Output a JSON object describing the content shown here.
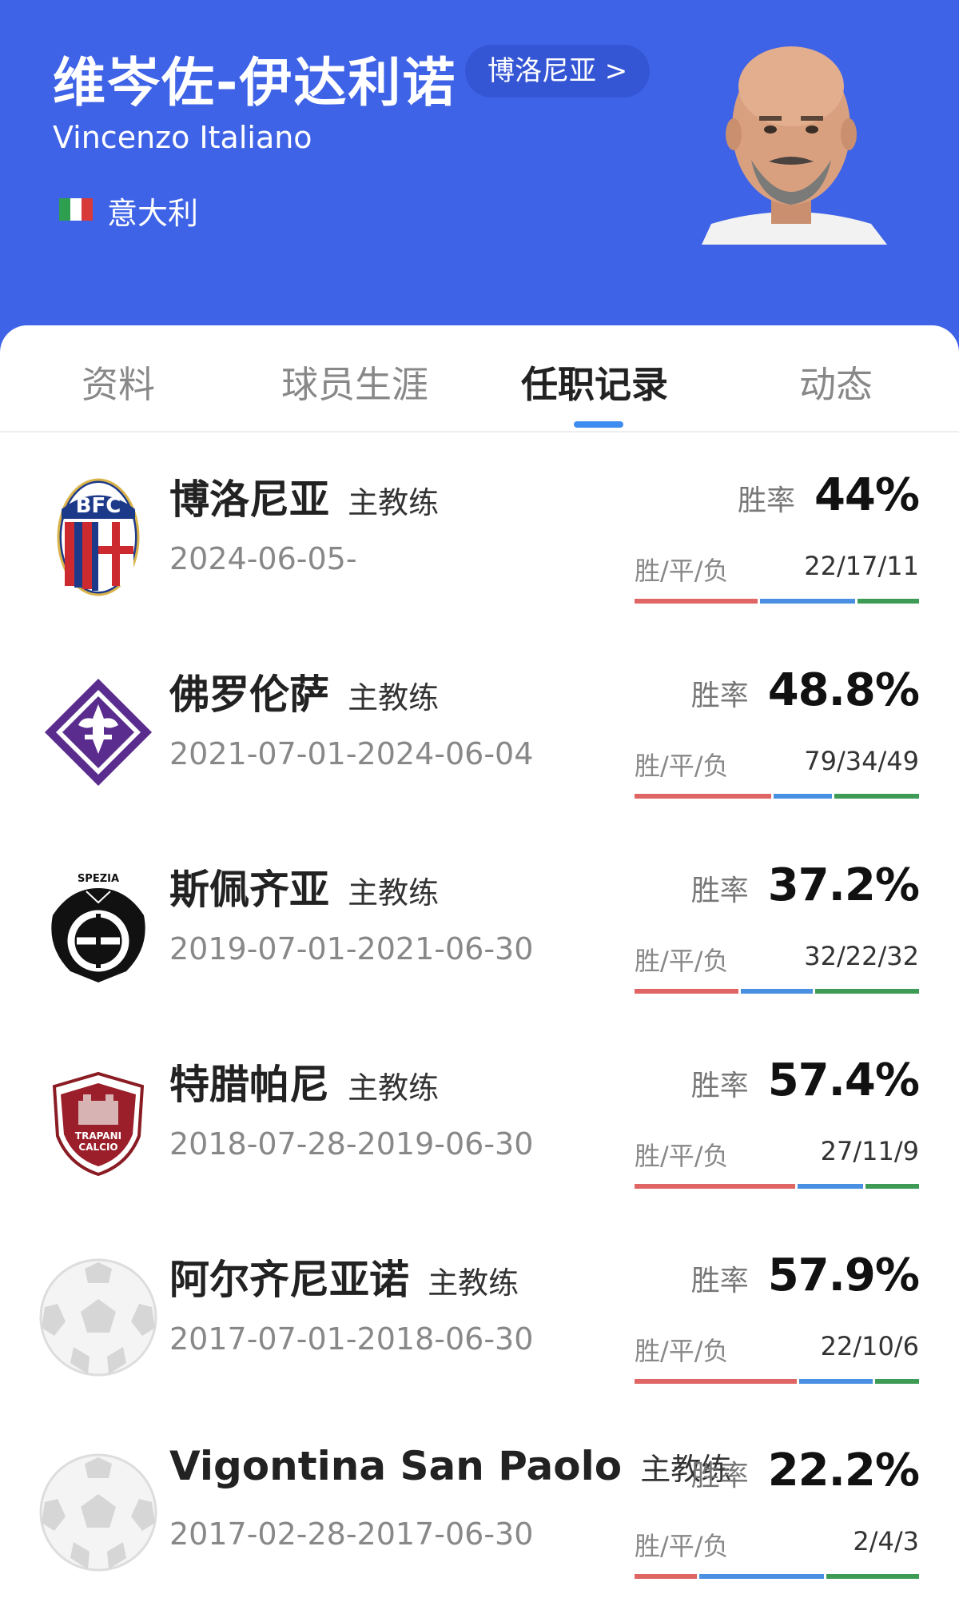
{
  "coach": {
    "name_cn": "维岑佐-伊达利诺",
    "name_en": "Vincenzo Italiano",
    "club_link": "博洛尼亚 >",
    "nationality": "意大利"
  },
  "tabs": [
    {
      "label": "资料",
      "active": false
    },
    {
      "label": "球员生涯",
      "active": false
    },
    {
      "label": "任职记录",
      "active": true
    },
    {
      "label": "动态",
      "active": false
    }
  ],
  "labels": {
    "rate": "胜率",
    "wdl": "胜/平/负"
  },
  "colors": {
    "header": "#3f63e6",
    "win": "#e06565",
    "draw": "#4a90e2",
    "loss": "#3e9b56",
    "tab_indicator": "#3f8cf0"
  },
  "records": [
    {
      "team": "博洛尼亚",
      "role": "主教练",
      "dates": "2024-06-05-",
      "rate": "44%",
      "wdl": "22/17/11",
      "w": 22,
      "d": 17,
      "l": 11,
      "logo": "bologna-logo"
    },
    {
      "team": "佛罗伦萨",
      "role": "主教练",
      "dates": "2021-07-01-2024-06-04",
      "rate": "48.8%",
      "wdl": "79/34/49",
      "w": 79,
      "d": 34,
      "l": 49,
      "logo": "fiorentina-logo"
    },
    {
      "team": "斯佩齐亚",
      "role": "主教练",
      "dates": "2019-07-01-2021-06-30",
      "rate": "37.2%",
      "wdl": "32/22/32",
      "w": 32,
      "d": 22,
      "l": 32,
      "logo": "spezia-logo"
    },
    {
      "team": "特腊帕尼",
      "role": "主教练",
      "dates": "2018-07-28-2019-06-30",
      "rate": "57.4%",
      "wdl": "27/11/9",
      "w": 27,
      "d": 11,
      "l": 9,
      "logo": "trapani-logo"
    },
    {
      "team": "阿尔齐尼亚诺",
      "role": "主教练",
      "dates": "2017-07-01-2018-06-30",
      "rate": "57.9%",
      "wdl": "22/10/6",
      "w": 22,
      "d": 10,
      "l": 6,
      "logo": "football-placeholder-logo"
    },
    {
      "team": "Vigontina San Paolo",
      "role": "主教练",
      "dates": "2017-02-28-2017-06-30",
      "rate": "22.2%",
      "wdl": "2/4/3",
      "w": 2,
      "d": 4,
      "l": 3,
      "logo": "football-placeholder-logo"
    }
  ]
}
